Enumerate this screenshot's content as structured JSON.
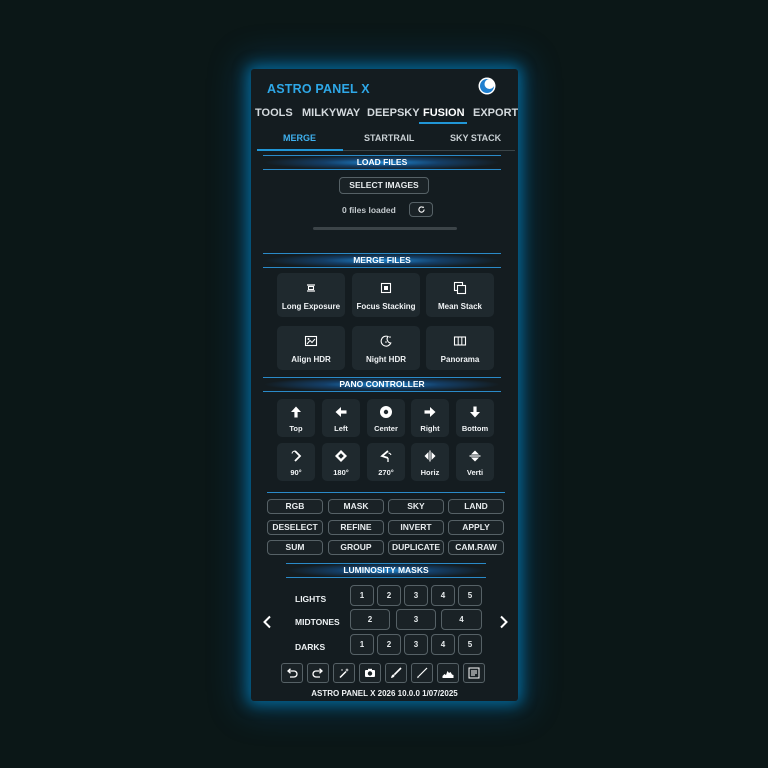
{
  "app": {
    "title": "ASTRO PANEL X"
  },
  "tabs": [
    {
      "label": "TOOLS"
    },
    {
      "label": "MILKYWAY"
    },
    {
      "label": "DEEPSKY"
    },
    {
      "label": "FUSION",
      "active": true
    },
    {
      "label": "EXPORT"
    }
  ],
  "subtabs": [
    {
      "label": "MERGE",
      "active": true
    },
    {
      "label": "STARTRAIL"
    },
    {
      "label": "SKY STACK"
    }
  ],
  "load_files": {
    "header": "LOAD FILES",
    "select_label": "SELECT IMAGES",
    "status": "0 files loaded",
    "progress": 0
  },
  "merge_files": {
    "header": "MERGE FILES",
    "items": [
      {
        "label": "Long Exposure",
        "icon": "long-exposure-icon"
      },
      {
        "label": "Focus Stacking",
        "icon": "focus-stacking-icon"
      },
      {
        "label": "Mean Stack",
        "icon": "mean-stack-icon"
      },
      {
        "label": "Align HDR",
        "icon": "align-hdr-icon"
      },
      {
        "label": "Night HDR",
        "icon": "night-hdr-icon"
      },
      {
        "label": "Panorama",
        "icon": "panorama-icon"
      }
    ]
  },
  "pano": {
    "header": "PANO CONTROLLER",
    "row1": [
      {
        "label": "Top",
        "icon": "arrow-up-icon"
      },
      {
        "label": "Left",
        "icon": "arrow-left-icon"
      },
      {
        "label": "Center",
        "icon": "center-icon"
      },
      {
        "label": "Right",
        "icon": "arrow-right-icon"
      },
      {
        "label": "Bottom",
        "icon": "arrow-down-icon"
      }
    ],
    "row2": [
      {
        "label": "90°",
        "icon": "rotate-90-icon"
      },
      {
        "label": "180°",
        "icon": "rotate-180-icon"
      },
      {
        "label": "270°",
        "icon": "rotate-270-icon"
      },
      {
        "label": "Horiz",
        "icon": "flip-horizontal-icon"
      },
      {
        "label": "Verti",
        "icon": "flip-vertical-icon"
      }
    ]
  },
  "actions": {
    "rows": [
      [
        "RGB",
        "MASK",
        "SKY",
        "LAND"
      ],
      [
        "DESELECT",
        "REFINE",
        "INVERT",
        "APPLY"
      ],
      [
        "SUM",
        "GROUP",
        "DUPLICATE",
        "CAM.RAW"
      ]
    ]
  },
  "luminosity": {
    "header": "LUMINOSITY MASKS",
    "lights_label": "LIGHTS",
    "midtones_label": "MIDTONES",
    "darks_label": "DARKS",
    "lights": [
      "1",
      "2",
      "3",
      "4",
      "5"
    ],
    "midtones": [
      "2",
      "3",
      "4"
    ],
    "darks": [
      "1",
      "2",
      "3",
      "4",
      "5"
    ]
  },
  "toolbar": {
    "icons": [
      "undo-icon",
      "redo-icon",
      "magic-wand-icon",
      "camera-icon",
      "brush-icon",
      "fine-brush-icon",
      "histogram-icon",
      "info-panel-icon"
    ]
  },
  "footer": {
    "text": "ASTRO PANEL X 2026 10.0.0 1/07/2025"
  },
  "colors": {
    "accent": "#2196d6",
    "panel": "#141c20",
    "background": "#0b1717"
  }
}
